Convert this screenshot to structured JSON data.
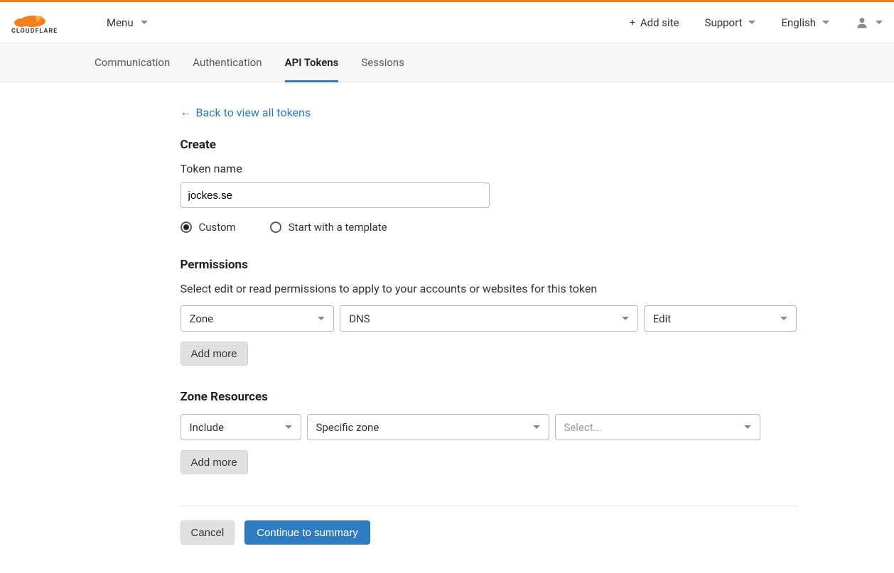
{
  "brand": "CLOUDFLARE",
  "header": {
    "menu": "Menu",
    "add_site": "Add site",
    "support": "Support",
    "language": "English"
  },
  "tabs": {
    "communication": "Communication",
    "authentication": "Authentication",
    "api_tokens": "API Tokens",
    "sessions": "Sessions",
    "active": "api_tokens"
  },
  "back_link": "Back to view all tokens",
  "create": {
    "heading": "Create",
    "token_name_label": "Token name",
    "token_name_value": "jockes.se",
    "radio_custom": "Custom",
    "radio_template": "Start with a template",
    "radio_selected": "custom"
  },
  "permissions": {
    "heading": "Permissions",
    "description": "Select edit or read permissions to apply to your accounts or websites for this token",
    "row": {
      "scope": "Zone",
      "resource": "DNS",
      "access": "Edit"
    },
    "add_more": "Add more"
  },
  "zone_resources": {
    "heading": "Zone Resources",
    "row": {
      "mode": "Include",
      "scope": "Specific zone",
      "select_placeholder": "Select..."
    },
    "add_more": "Add more"
  },
  "footer": {
    "cancel": "Cancel",
    "continue": "Continue to summary"
  }
}
